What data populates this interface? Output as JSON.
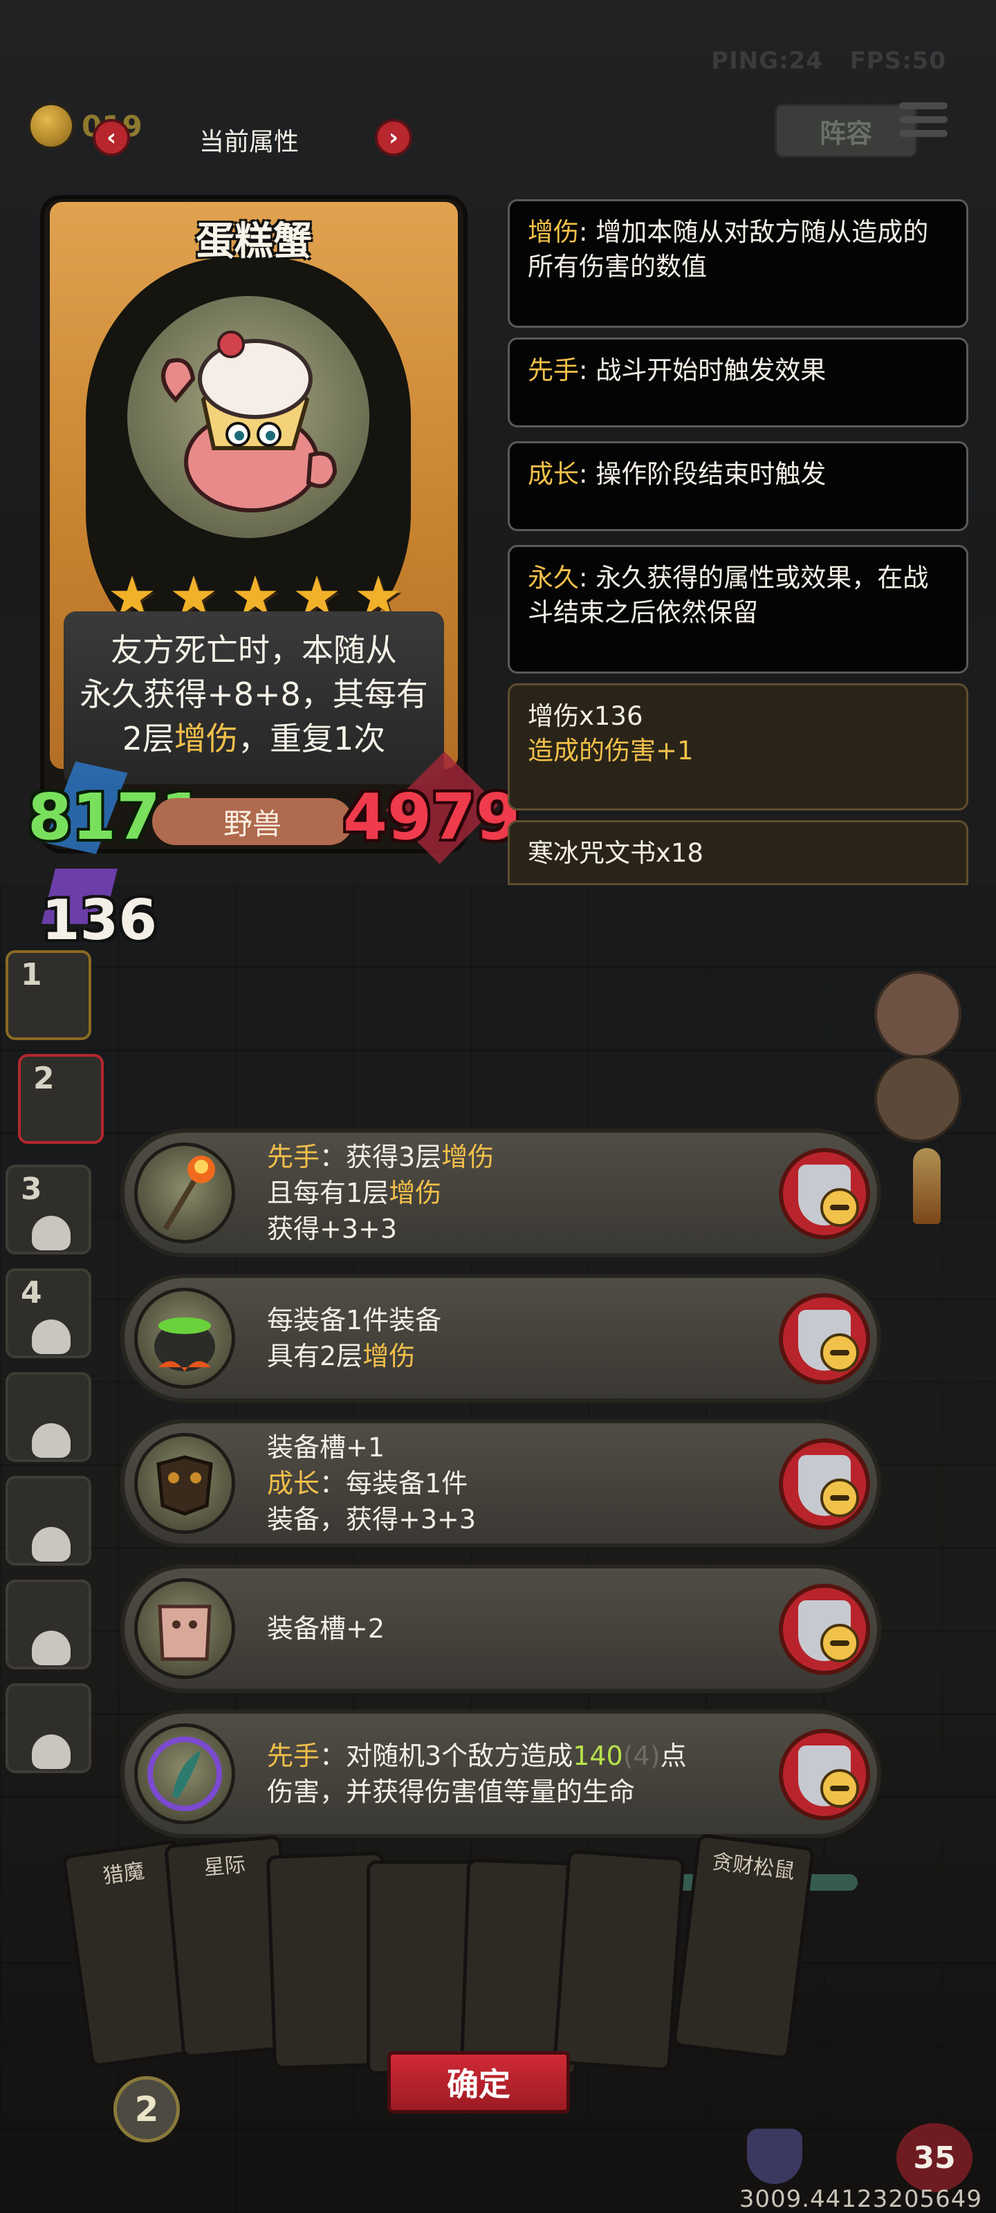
{
  "hud": {
    "ping": "PING:24",
    "fps": "FPS:50",
    "coins": "0",
    "coins_suffix": "19",
    "lineup_label": "阵容"
  },
  "panel": {
    "title": "当前属性",
    "prev_icon": "chevron-left-icon",
    "next_icon": "chevron-right-icon"
  },
  "card": {
    "name": "蛋糕蟹",
    "stars": 5,
    "description_lines": [
      "友方死亡时，本随从",
      "永久获得+8+8，其每有"
    ],
    "desc_line3_num": "2层",
    "desc_line3_kw": "增伤",
    "desc_line3_rest": "，重复1次",
    "attack": "8171",
    "tribe": "野兽",
    "health": "4979",
    "level": "136"
  },
  "keywords": [
    {
      "key": "增伤",
      "text": ": 增加本随从对敌方随从造成的所有伤害的数值"
    },
    {
      "key": "先手",
      "text": ": 战斗开始时触发效果"
    },
    {
      "key": "成长",
      "text": ": 操作阶段结束时触发"
    },
    {
      "key": "永久",
      "text": ": 永久获得的属性或效果，在战斗结束之后依然保留"
    }
  ],
  "stacks": [
    {
      "title": "增伤x136",
      "sub": "造成的伤害+1"
    },
    {
      "title": "寒冰咒文书x18",
      "sub": ""
    }
  ],
  "slots": [
    "1",
    "2",
    "3",
    "4",
    "",
    "",
    "",
    ""
  ],
  "equipment": [
    {
      "icon": "torch-staff-icon",
      "l1_kw": "先手",
      "l1_rest": "：获得3层",
      "l1_kw2": "增伤",
      "l2_pre": "且每有1层",
      "l2_kw": "增伤",
      "l3": "获得+3+3"
    },
    {
      "icon": "cauldron-icon",
      "l1": "每装备1件装备",
      "l2_pre": "具有2层",
      "l2_kw": "增伤"
    },
    {
      "icon": "armor-icon",
      "l1": "装备槽+1",
      "l2_kw": "成长",
      "l2_rest": "：每装备1件",
      "l3": "装备，获得+3+3"
    },
    {
      "icon": "pig-chest-icon",
      "l1": "装备槽+2"
    },
    {
      "icon": "feather-shield-icon",
      "l1_kw": "先手",
      "l1_pre": "：对随机3个敌方造成",
      "l1_num": "140",
      "l1_dim": "(4)",
      "l1_end": "点",
      "l2": "伤害，并获得伤害值等量的生命"
    }
  ],
  "hand": {
    "cards": [
      "猎魔",
      "星际",
      "",
      "",
      "",
      "",
      "贪财松鼠"
    ],
    "confirm_label": "确定",
    "mana": "2",
    "health": "35",
    "coords": "3009.44123205649"
  },
  "colors": {
    "keyword": "#f2c04a",
    "attack": "#79e05d",
    "health": "#ef3b4c",
    "confirm": "#c1222c"
  }
}
